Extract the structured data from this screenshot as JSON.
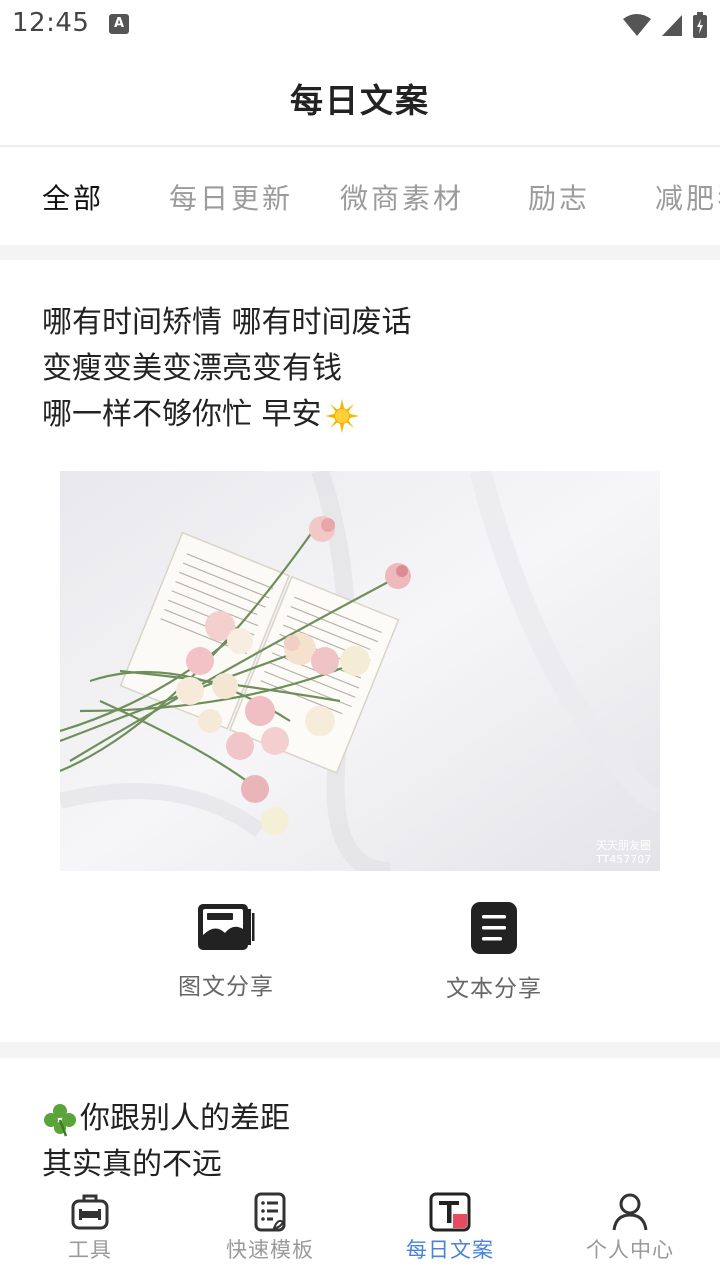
{
  "status_bar": {
    "time": "12:45",
    "notification_icon": "A"
  },
  "header": {
    "title": "每日文案"
  },
  "tabs": [
    {
      "label": "全部",
      "active": true
    },
    {
      "label": "每日更新",
      "active": false
    },
    {
      "label": "微商素材",
      "active": false
    },
    {
      "label": "励志",
      "active": false
    },
    {
      "label": "减肥狂",
      "active": false
    }
  ],
  "posts": [
    {
      "lines": [
        "哪有时间矫情 哪有时间废话",
        "变瘦变美变漂亮变有钱",
        "哪一样不够你忙 早安"
      ],
      "image_watermark": [
        "天天朋友圈",
        "TT457707"
      ],
      "share_image_label": "图文分享",
      "share_text_label": "文本分享"
    },
    {
      "lines": [
        "你跟别人的差距",
        "其实真的不远"
      ]
    }
  ],
  "bottom_nav": [
    {
      "label": "工具",
      "icon": "toolbox-icon",
      "active": false
    },
    {
      "label": "快速模板",
      "icon": "template-icon",
      "active": false
    },
    {
      "label": "每日文案",
      "icon": "daily-text-icon",
      "active": true
    },
    {
      "label": "个人中心",
      "icon": "person-icon",
      "active": false
    }
  ],
  "colors": {
    "accent": "#4a84d8",
    "active_icon_red": "#e84a5f",
    "inactive": "#9a9a9a"
  }
}
